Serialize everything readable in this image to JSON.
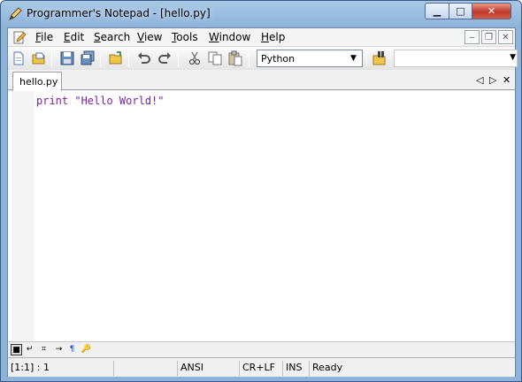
{
  "window": {
    "title": "Programmer's Notepad - [hello.py]",
    "min_glyph": "▁",
    "max_glyph": "□",
    "close_glyph": "✕"
  },
  "menu": {
    "items": [
      {
        "key": "F",
        "rest": "ile"
      },
      {
        "key": "E",
        "rest": "dit"
      },
      {
        "key": "S",
        "rest": "earch"
      },
      {
        "key": "V",
        "rest": "iew"
      },
      {
        "key": "T",
        "rest": "ools"
      },
      {
        "key": "W",
        "rest": "indow"
      },
      {
        "key": "H",
        "rest": "elp"
      }
    ],
    "mdi_min": "‒",
    "mdi_restore": "❐",
    "mdi_close": "✕"
  },
  "toolbar": {
    "icons": [
      "new-file-icon",
      "open-file-icon",
      "save-icon",
      "save-all-icon",
      "open-folder-icon",
      "undo-icon",
      "redo-icon",
      "cut-icon",
      "copy-icon",
      "paste-icon",
      "find-icon"
    ],
    "scheme": "Python",
    "dropdown_arrow": "▼"
  },
  "tabs": [
    {
      "label": "hello.py"
    }
  ],
  "tab_nav": {
    "prev": "◁",
    "next": "▷",
    "close": "✕"
  },
  "editor": {
    "keyword": "print",
    "string": "\"Hello World!\""
  },
  "whitespace_toolbar": {
    "items": [
      "■",
      "↵",
      "⌗",
      "→",
      "¶",
      "🔑"
    ]
  },
  "status": {
    "position": "[1:1] : 1",
    "encoding": "ANSI",
    "line_endings": "CR+LF",
    "mode": "INS",
    "state": "Ready"
  },
  "colors": {
    "keyword": "#7b1fa2",
    "title_gradient": "#a9c8e6",
    "close_button": "#c0392b"
  }
}
